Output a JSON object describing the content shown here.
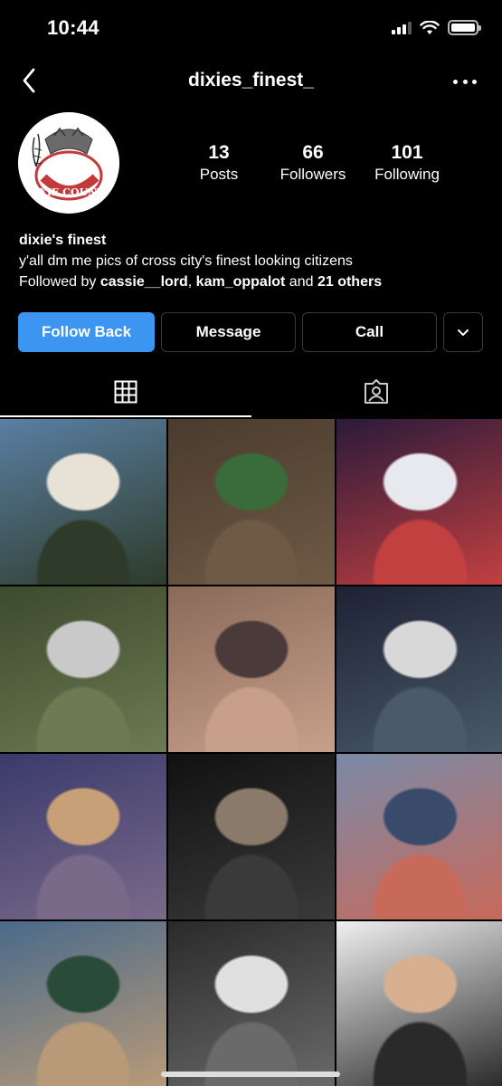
{
  "status_bar": {
    "time": "10:44"
  },
  "nav": {
    "title": "dixies_finest_",
    "back_icon": "chevron-left-icon",
    "more_icon": "ellipsis-icon"
  },
  "profile": {
    "avatar_text": "DIXIE COUNTY",
    "stats": [
      {
        "count": "13",
        "label": "Posts"
      },
      {
        "count": "66",
        "label": "Followers"
      },
      {
        "count": "101",
        "label": "Following"
      }
    ],
    "name": "dixie's finest",
    "bio": "y'all dm me pics of cross city's finest looking citizens",
    "followed_prefix": "Followed by ",
    "followed_user1": "cassie__lord",
    "followed_sep": ", ",
    "followed_user2": "kam_oppalot",
    "followed_and": " and ",
    "followed_others": "21 others"
  },
  "actions": {
    "follow_back": "Follow Back",
    "message": "Message",
    "call": "Call"
  },
  "tabs": [
    {
      "icon": "grid-icon",
      "active": true
    },
    {
      "icon": "tagged-icon",
      "active": false
    }
  ],
  "grid": {
    "cells": [
      {
        "colors": [
          "#5a7fa3",
          "#2e3b2a",
          "#e8e2d6"
        ]
      },
      {
        "colors": [
          "#4a3b2e",
          "#6f5a45",
          "#3a6b3a"
        ]
      },
      {
        "colors": [
          "#2a1a3a",
          "#c24040",
          "#e8e8ef"
        ]
      },
      {
        "colors": [
          "#3c4a2e",
          "#6d7a52",
          "#c9c9c9"
        ]
      },
      {
        "colors": [
          "#8a6a5a",
          "#c8a08a",
          "#4a3a3a"
        ]
      },
      {
        "colors": [
          "#1d2233",
          "#4a5a6b",
          "#d8d8d8"
        ]
      },
      {
        "colors": [
          "#3a3a6b",
          "#7a6a8a",
          "#c8a078"
        ]
      },
      {
        "colors": [
          "#111111",
          "#3a3a3a",
          "#8a7a6a"
        ]
      },
      {
        "colors": [
          "#7a8aa8",
          "#c86a5a",
          "#3a4a6b"
        ]
      },
      {
        "colors": [
          "#4a6a8a",
          "#b89a78",
          "#2a4a3a"
        ]
      },
      {
        "colors": [
          "#2a2a2a",
          "#6a6a6a",
          "#e0e0e0"
        ]
      },
      {
        "colors": [
          "#f0f0f0",
          "#2a2a2a",
          "#d8b090"
        ]
      }
    ]
  }
}
